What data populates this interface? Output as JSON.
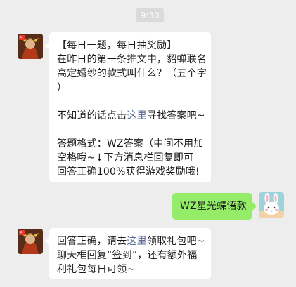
{
  "timestamp": "9:30",
  "messages": [
    {
      "sender": "official-account",
      "lines": [
        [
          "【每日一题，每日抽奖励】"
        ],
        [
          "在昨日的第一条推文中，貂蝉联名"
        ],
        [
          "高定婚纱的款式叫什么？（五个字"
        ],
        [
          "）"
        ],
        [],
        [
          "不知道的话点击",
          {
            "link": "这里"
          },
          "寻找答案吧~"
        ],
        [],
        [
          "答题格式：WZ答案（中间不用加"
        ],
        [
          "空格哦~↓下方消息栏回复即可"
        ],
        [
          "回答正确100%获得游戏奖励哦!"
        ]
      ]
    },
    {
      "sender": "me",
      "lines": [
        [
          "WZ星光蝶语款"
        ]
      ]
    },
    {
      "sender": "official-account",
      "lines": [
        [
          "回答正确，请去",
          {
            "link": "这里"
          },
          "领取礼包吧~"
        ],
        [
          "聊天框回复“签到”，还有额外福"
        ],
        [
          "利礼包每日可领~"
        ]
      ]
    }
  ],
  "colors": {
    "background": "#ededed",
    "bubble_in": "#ffffff",
    "bubble_out": "#95ec69",
    "link": "#576b95"
  },
  "icons": {
    "official_avatar": "game-hero-avatar",
    "user_avatar": "bunny-avatar"
  }
}
